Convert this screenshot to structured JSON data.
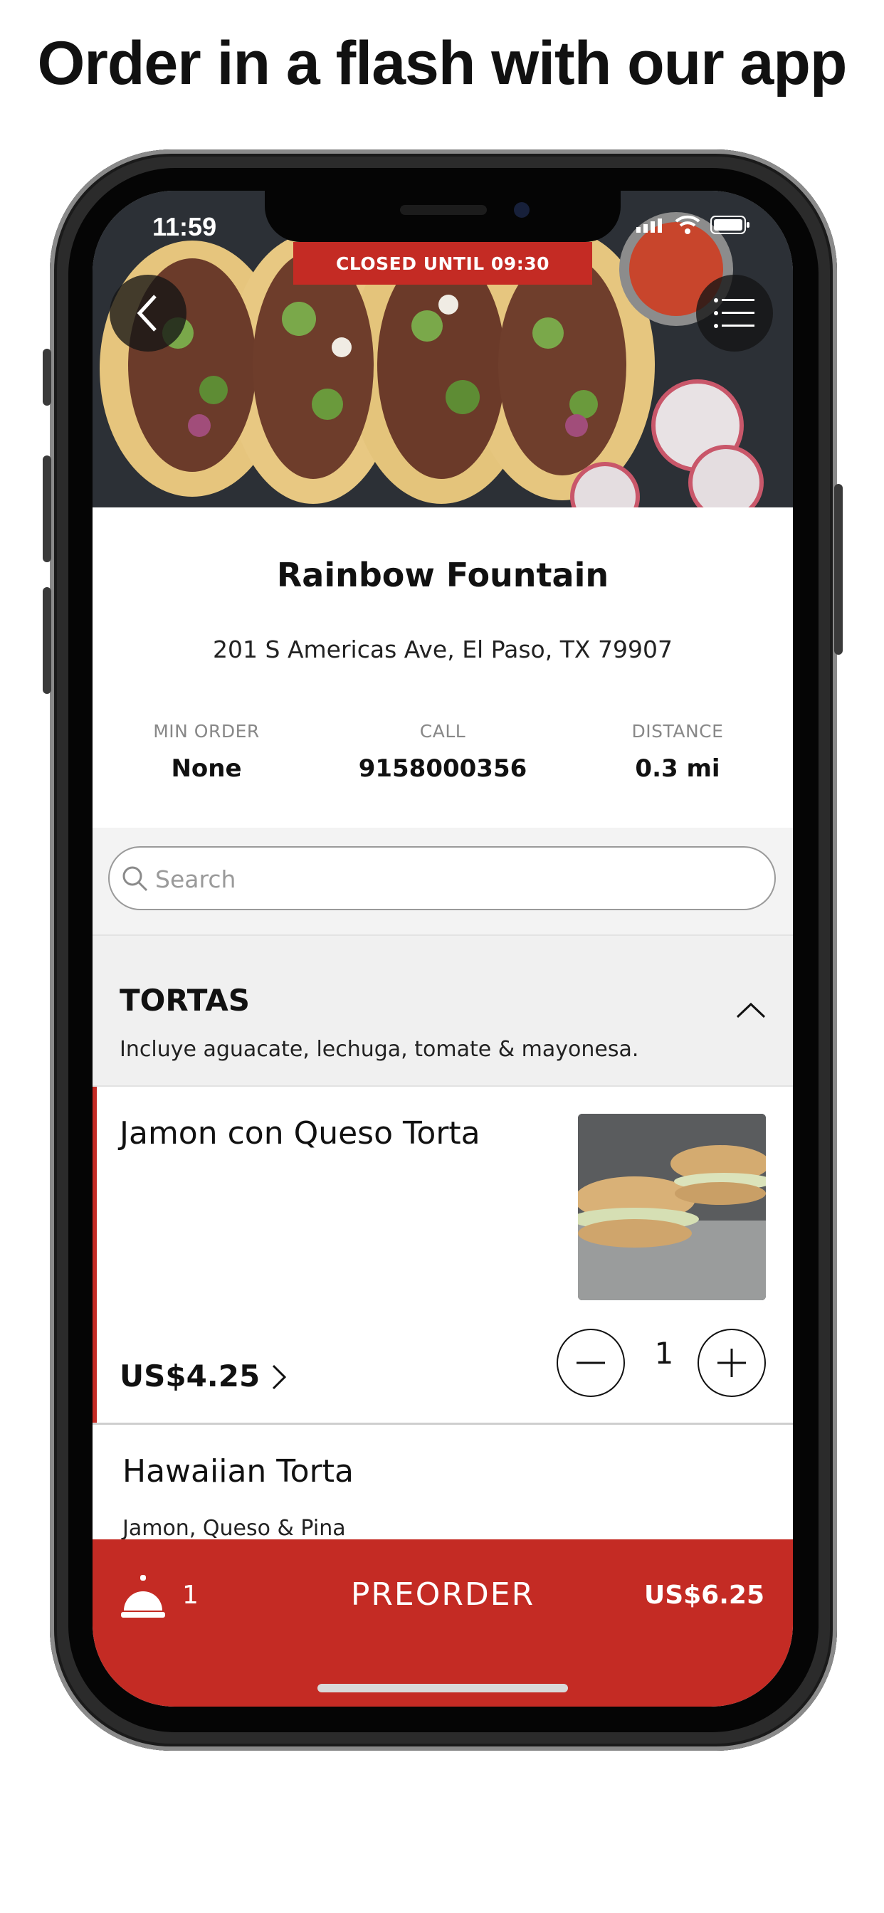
{
  "headline": "Order in a flash with our app",
  "status_bar": {
    "time": "11:59"
  },
  "hero": {
    "closed_banner": "CLOSED UNTIL 09:30"
  },
  "restaurant": {
    "name": "Rainbow Fountain",
    "address": "201 S Americas Ave, El Paso, TX 79907",
    "stats": [
      {
        "label": "MIN ORDER",
        "value": "None"
      },
      {
        "label": "CALL",
        "value": "9158000356"
      },
      {
        "label": "DISTANCE",
        "value": "0.3 mi"
      }
    ]
  },
  "search": {
    "placeholder": "Search"
  },
  "category": {
    "title": "TORTAS",
    "description": "Incluye aguacate, lechuga, tomate & mayonesa."
  },
  "items": [
    {
      "name": "Jamon con Queso Torta",
      "price": "US$4.25",
      "quantity": "1"
    },
    {
      "name": "Hawaiian Torta",
      "description": "Jamon, Queso & Pina"
    }
  ],
  "cart": {
    "count": "1",
    "action_label": "PREORDER",
    "total": "US$6.25"
  },
  "colors": {
    "accent": "#c42b24",
    "background": "#f3f3f3"
  },
  "icons": [
    "back-icon",
    "menu-icon",
    "search-icon",
    "chevron-up-icon",
    "chevron-right-icon",
    "minus-icon",
    "plus-icon",
    "service-bell-icon",
    "wifi-icon",
    "battery-icon",
    "signal-icon"
  ]
}
